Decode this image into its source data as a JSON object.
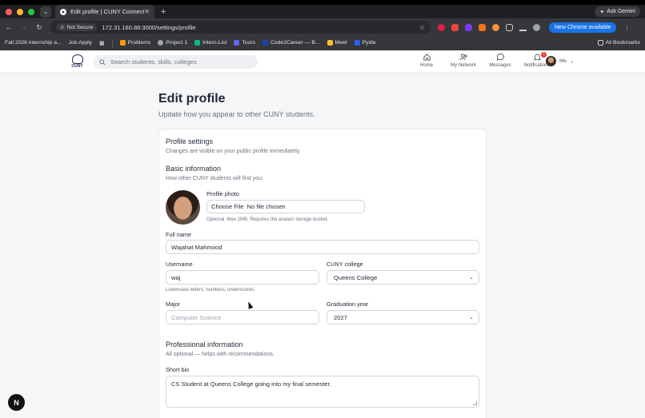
{
  "browser": {
    "tab_title": "Edit profile | CUNY Connect",
    "ask_label": "Ask Gemini",
    "security_label": "Not Secure",
    "url": "172.31.160.88:3000/settings/profile",
    "new_chrome_label": "New Chrome available",
    "bookmarks": [
      {
        "label": "Fall 2026 internship a...",
        "color": "#3b82f6"
      },
      {
        "label": "Job Apply",
        "color": "#0a66c2"
      },
      {
        "label": "Problems",
        "color": "#f59e0b"
      },
      {
        "label": "Project 1",
        "color": "#9ca3af"
      },
      {
        "label": "Intern-List",
        "color": "#10b981"
      },
      {
        "label": "Tours",
        "color": "#6366f1"
      },
      {
        "label": "Code2Career — B...",
        "color": "#1e40af"
      },
      {
        "label": "Meet",
        "color": "#fbbf24"
      },
      {
        "label": "Pydle",
        "color": "#2563eb"
      }
    ],
    "all_bookmarks_label": "All Bookmarks"
  },
  "app": {
    "logo_text": "CUNY",
    "search_placeholder": "Search students, skills, colleges",
    "nav": {
      "home": "Home",
      "network": "My Network",
      "messages": "Messages",
      "notifications": "Notifications",
      "notifications_count": "1",
      "me": "Me"
    }
  },
  "page": {
    "title": "Edit profile",
    "subtitle": "Update how you appear to other CUNY students.",
    "settings_title": "Profile settings",
    "settings_desc": "Changes are visible on your public profile immediately.",
    "basic_title": "Basic information",
    "basic_desc": "How other CUNY students will find you.",
    "photo_label": "Profile photo",
    "choose_file": "Choose File",
    "no_file": "No file chosen",
    "photo_hint": "Optional. Max 2MB. Requires the avatars storage bucket.",
    "fullname_label": "Full name",
    "fullname_value": "Wajahat Mahmood",
    "username_label": "Username",
    "username_value": "waj",
    "username_hint": "Lowercase letters, numbers, underscores.",
    "college_label": "CUNY college",
    "college_value": "Queens College",
    "major_label": "Major",
    "major_placeholder": "Computer Science",
    "grad_label": "Graduation year",
    "grad_value": "2027",
    "pro_title": "Professional information",
    "pro_desc": "All optional — helps with recommendations.",
    "bio_label": "Short bio",
    "bio_value": "CS Student at Queens College going into my final semester."
  },
  "fab_label": "N"
}
